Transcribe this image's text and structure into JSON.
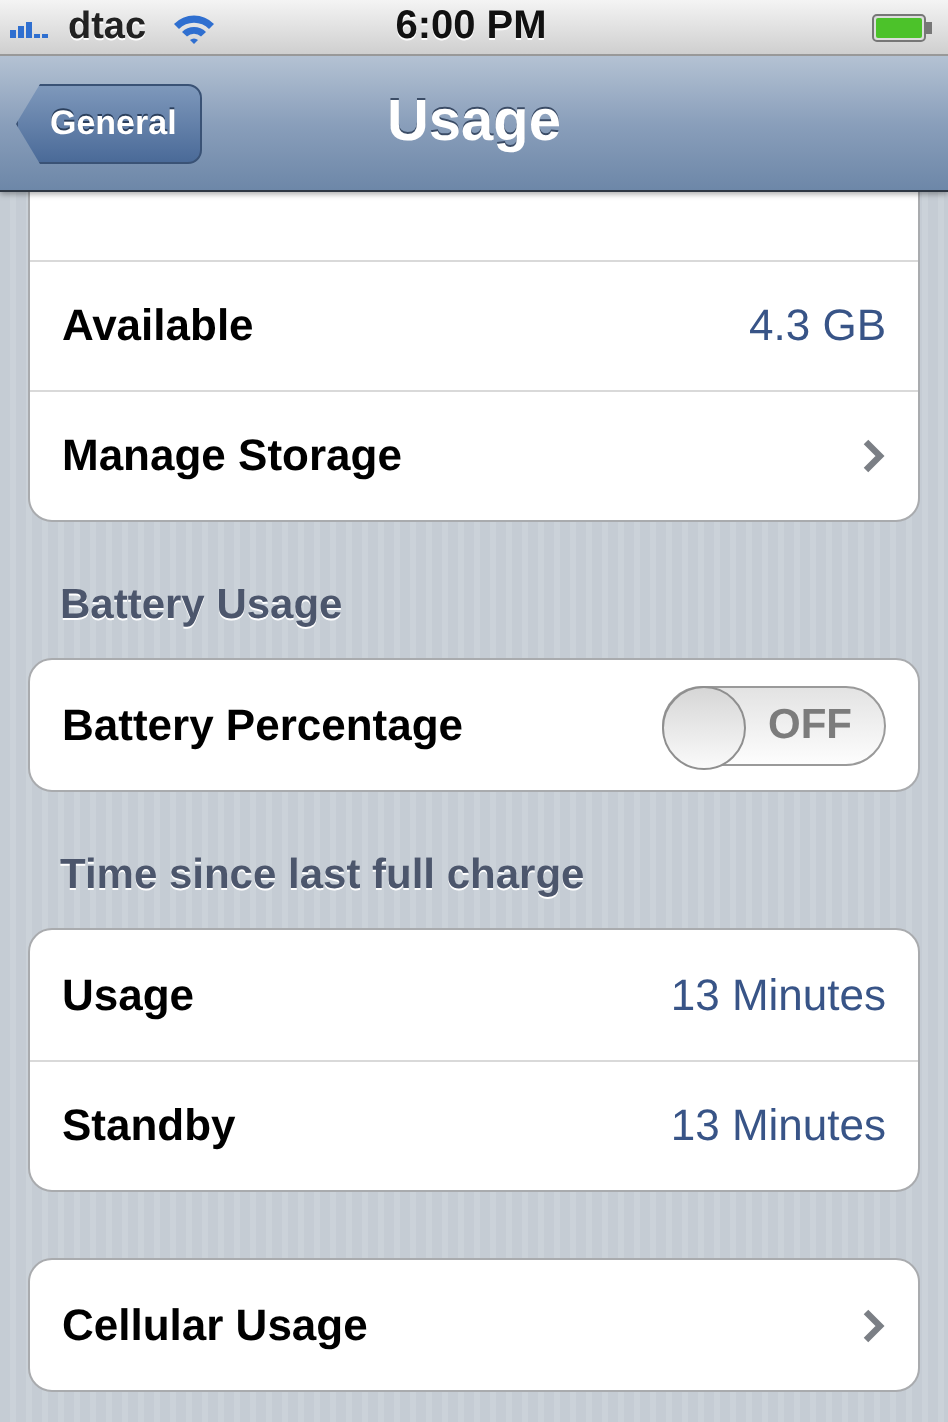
{
  "status_bar": {
    "carrier": "dtac",
    "time": "6:00 PM"
  },
  "nav_bar": {
    "back_button": "General",
    "title": "Usage"
  },
  "groups": [
    {
      "rows": [
        {
          "kind": "blank"
        },
        {
          "kind": "value",
          "label": "Available",
          "value": "4.3 GB"
        },
        {
          "kind": "link",
          "label": "Manage Storage"
        }
      ]
    },
    {
      "header": "Battery Usage",
      "rows": [
        {
          "kind": "switch",
          "label": "Battery Percentage",
          "on": false,
          "switch_text": "OFF"
        }
      ]
    },
    {
      "header": "Time since last full charge",
      "rows": [
        {
          "kind": "value",
          "label": "Usage",
          "value": "13 Minutes"
        },
        {
          "kind": "value",
          "label": "Standby",
          "value": "13 Minutes"
        }
      ]
    },
    {
      "rows": [
        {
          "kind": "link",
          "label": "Cellular Usage"
        }
      ]
    }
  ]
}
